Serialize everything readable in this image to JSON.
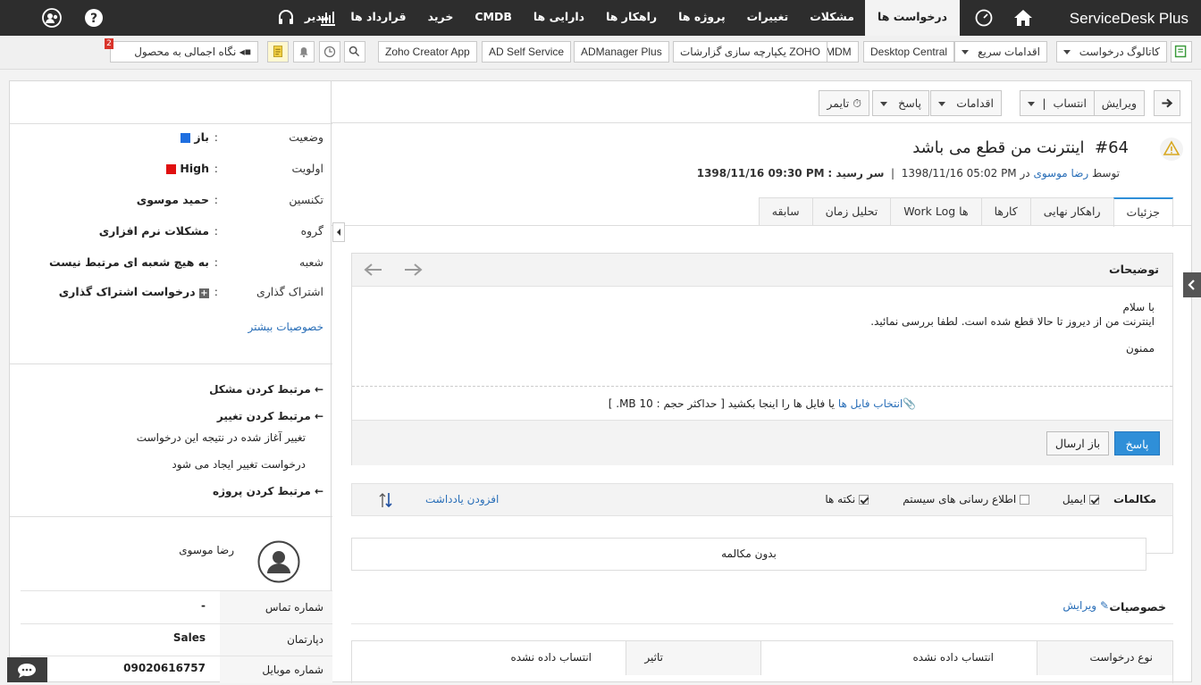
{
  "header": {
    "logo": "ServiceDesk Plus",
    "nav": [
      "درخواست ها",
      "مشکلات",
      "تغییرات",
      "پروژه ها",
      "راهکار ها",
      "دارایی ها",
      "CMDB",
      "خرید",
      "قرارداد ها",
      "مدیر"
    ]
  },
  "toolbar": {
    "catalog": "کاتالوگ درخواست",
    "quick_actions": "اقدامات سریع",
    "links": [
      "Desktop Central",
      "MDM",
      "یکپارچه سازی گزارشات ZOHO",
      "ADManager Plus",
      "AD Self Service",
      "Zoho Creator App"
    ],
    "product_overview": "نگاه اجمالی به محصول",
    "badge": "2"
  },
  "actions": {
    "edit": "ویرایش",
    "assign": "انتساب",
    "actions": "اقدامات",
    "reply": "پاسخ",
    "timer": "تایمر"
  },
  "request": {
    "id": "#64",
    "title": "اینترنت من قطع می باشد",
    "by_label": "توسط",
    "requester": "رضا موسوی",
    "in_label": "در",
    "created": "1398/11/16 05:02 PM",
    "due_label": "سر رسید :",
    "due": "1398/11/16 09:30 PM"
  },
  "tabs": [
    "جزئیات",
    "راهکار نهایی",
    "کارها",
    "Work Log ها",
    "تحلیل زمان",
    "سابقه"
  ],
  "description": {
    "label": "توضیحات",
    "line1": "با سلام",
    "line2": "اینترنت من از دیروز تا حالا قطع شده است. لطفا بررسی نمائید.",
    "line3": "ممنون",
    "attach_link": "انتخاب فایل ها",
    "attach_text": "یا فایل ها را اینجا بکشید [ حداکثر حجم : 10 MB. ]",
    "reply_btn": "پاسخ",
    "forward_btn": "باز ارسال"
  },
  "conversations": {
    "label": "مکالمات",
    "email": "ایمیل",
    "system": "اطلاع رسانی های سیستم",
    "notes": "نکته ها",
    "add_note": "افزودن یادداشت",
    "empty": "بدون مکالمه"
  },
  "properties": {
    "label": "خصوصیات",
    "edit": "ویرایش",
    "type_label": "نوع درخواست",
    "type_value": "انتساب داده نشده",
    "impact_label": "تاثیر",
    "impact_value": "انتساب داده نشده"
  },
  "left": {
    "status_label": "وضعیت",
    "status": "باز",
    "status_color": "#1f6fe0",
    "priority_label": "اولویت",
    "priority": "High",
    "priority_color": "#e01010",
    "tech_label": "تکنسین",
    "tech": "حمید موسوی",
    "group_label": "گروه",
    "group": "مشکلات نرم افزاری",
    "branch_label": "شعبه",
    "branch": "به هیچ شعبه ای مرتبط نیست",
    "share_label": "اشتراک گذاری",
    "share": "درخواست اشتراک گذاری",
    "more": "خصوصیات بیشتر",
    "link_problem": "مرتبط کردن مشکل",
    "link_change": "مرتبط کردن تغییر",
    "change_initiated": "تغییر آغاز شده در نتیجه این درخواست",
    "change_caused": "درخواست تغییر ایجاد می شود",
    "link_project": "مرتبط کردن پروژه",
    "user_name": "رضا موسوی",
    "contact_label": "شماره تماس",
    "contact": "-",
    "dept_label": "دپارتمان",
    "dept": "Sales",
    "mobile_label": "شماره موبایل",
    "mobile": "09020616757"
  }
}
